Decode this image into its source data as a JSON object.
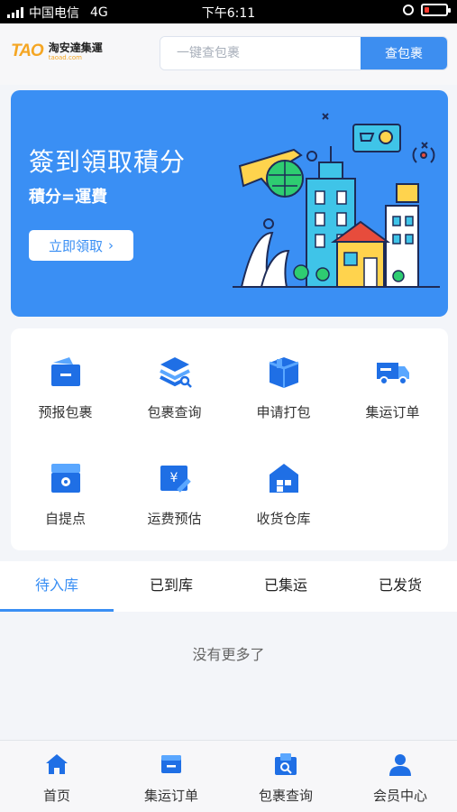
{
  "status_bar": {
    "carrier": "中国电信",
    "network": "4G",
    "time": "下午6:11"
  },
  "header": {
    "logo_mark": "TAO",
    "logo_name": "淘安達集運",
    "logo_url": "taoad.com",
    "search_placeholder": "一键查包裹",
    "search_button": "查包裹"
  },
  "banner": {
    "title": "簽到領取積分",
    "subtitle": "積分=運費",
    "button": "立即領取",
    "button_icon": "chevron-right-icon"
  },
  "grid": [
    {
      "label": "预报包裹",
      "icon": "wallet-icon"
    },
    {
      "label": "包裹查询",
      "icon": "stack-search-icon"
    },
    {
      "label": "申请打包",
      "icon": "box-icon"
    },
    {
      "label": "集运订单",
      "icon": "truck-icon"
    },
    {
      "label": "自提点",
      "icon": "store-icon"
    },
    {
      "label": "运费预估",
      "icon": "price-tag-icon"
    },
    {
      "label": "收货仓库",
      "icon": "warehouse-icon"
    }
  ],
  "tabs": [
    {
      "label": "待入库",
      "active": true
    },
    {
      "label": "已到库",
      "active": false
    },
    {
      "label": "已集运",
      "active": false
    },
    {
      "label": "已发货",
      "active": false
    }
  ],
  "empty_text": "没有更多了",
  "bottom_nav": [
    {
      "label": "首页",
      "icon": "home-icon"
    },
    {
      "label": "集运订单",
      "icon": "orders-icon"
    },
    {
      "label": "包裹查询",
      "icon": "package-search-icon"
    },
    {
      "label": "会员中心",
      "icon": "user-icon"
    }
  ],
  "colors": {
    "accent": "#3a8ff4",
    "logo": "#f5a623",
    "battery_low": "#ff3b30",
    "background": "#f3f5f9"
  }
}
